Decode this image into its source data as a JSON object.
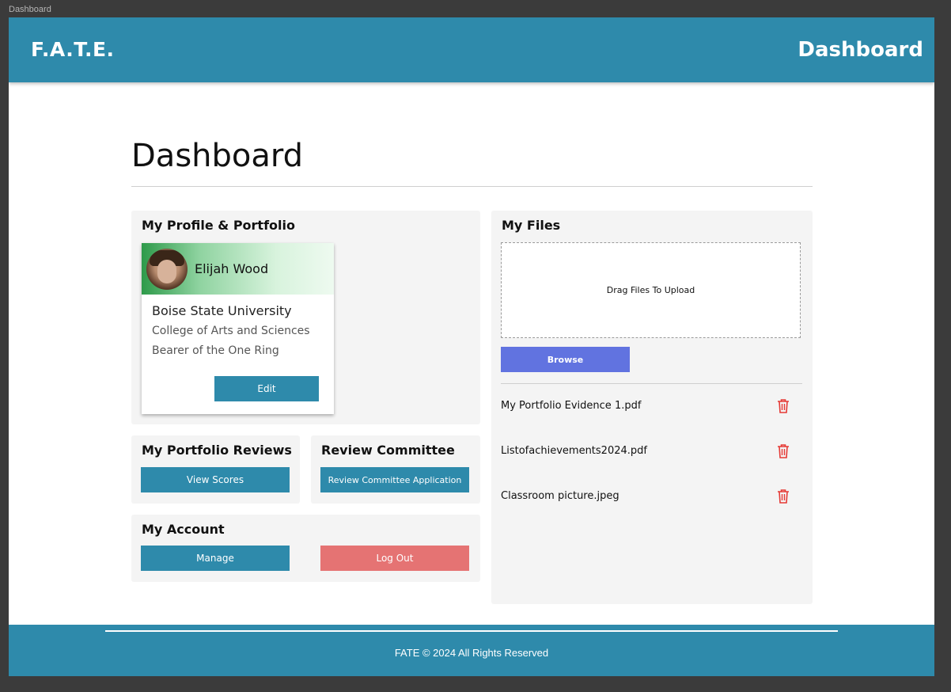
{
  "frame_label": "Dashboard",
  "header": {
    "brand": "F.A.T.E.",
    "title": "Dashboard"
  },
  "page_title": "Dashboard",
  "profile": {
    "panel_title": "My Profile & Portfolio",
    "name": "Elijah Wood",
    "university": "Boise State University",
    "college": "College of Arts and Sciences",
    "role": "Bearer of the One Ring",
    "edit_label": "Edit"
  },
  "reviews": {
    "panel_title": "My Portfolio Reviews",
    "button_label": "View Scores"
  },
  "committee": {
    "panel_title": "Review Committee",
    "button_label": "Review Committee Application"
  },
  "account": {
    "panel_title": "My Account",
    "manage_label": "Manage",
    "logout_label": "Log Out"
  },
  "files": {
    "panel_title": "My Files",
    "dropzone_text": "Drag Files To Upload",
    "browse_label": "Browse",
    "items": [
      {
        "name": "My Portfolio Evidence 1.pdf",
        "icon": "trash-icon"
      },
      {
        "name": "Listofachievements2024.pdf",
        "icon": "trash-icon"
      },
      {
        "name": "Classroom picture.jpeg",
        "icon": "trash-icon"
      }
    ]
  },
  "footer": {
    "text": "FATE © 2024 All Rights Reserved"
  },
  "colors": {
    "primary": "#2e8aab",
    "danger": "#e57373",
    "browse": "#6173e0",
    "trash": "#e53935"
  }
}
